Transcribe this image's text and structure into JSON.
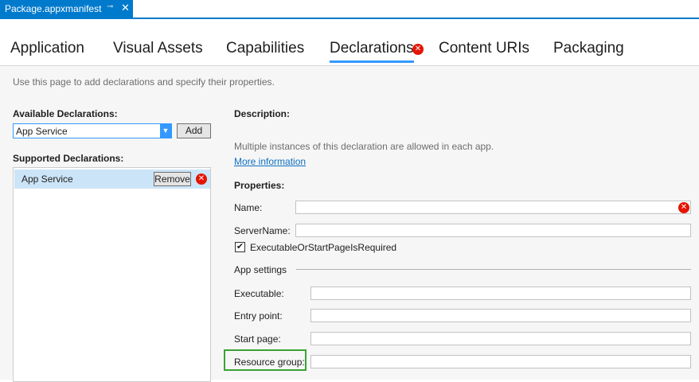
{
  "doc_tab": {
    "title": "Package.appxmanifest",
    "pin": "⊸",
    "close": "✕"
  },
  "tabs": [
    {
      "label": "Application"
    },
    {
      "label": "Visual Assets"
    },
    {
      "label": "Capabilities"
    },
    {
      "label": "Declarations",
      "active": true,
      "error": true
    },
    {
      "label": "Content URIs"
    },
    {
      "label": "Packaging"
    }
  ],
  "hint": "Use this page to add declarations and specify their properties.",
  "available": {
    "label": "Available Declarations:",
    "selected": "App Service",
    "add_label": "Add"
  },
  "supported": {
    "label": "Supported Declarations:",
    "items": [
      {
        "name": "App Service",
        "remove_label": "Remove"
      }
    ]
  },
  "description": {
    "label": "Description:",
    "text": "Multiple instances of this declaration are allowed in each app.",
    "link": "More information"
  },
  "properties": {
    "label": "Properties:",
    "name_label": "Name:",
    "name_value": "",
    "server_label": "ServerName:",
    "server_value": "",
    "checkbox_label": "ExecutableOrStartPageIsRequired",
    "checkbox_checked": true
  },
  "app_settings": {
    "label": "App settings",
    "executable_label": "Executable:",
    "entry_label": "Entry point:",
    "start_label": "Start page:",
    "resource_label": "Resource group:"
  },
  "icons": {
    "error": "error-circle-icon",
    "check": "✔",
    "arrow": "▼",
    "x": "✕"
  },
  "colors": {
    "accent": "#007acc",
    "selection": "#cce4f7",
    "error": "#e51400",
    "highlight": "#3aa335",
    "link": "#0e70c0"
  }
}
